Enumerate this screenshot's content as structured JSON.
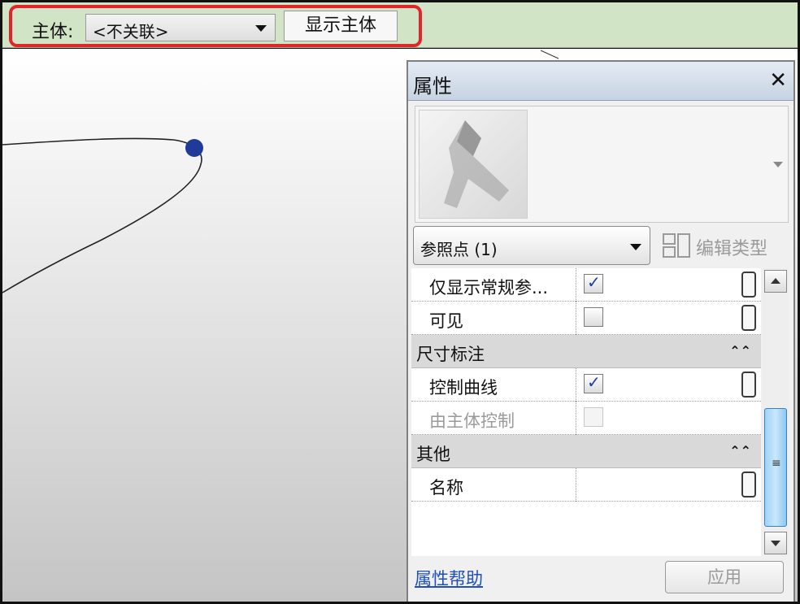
{
  "options_bar": {
    "host_label": "主体:",
    "host_value": "<不关联>",
    "show_host_label": "显示主体"
  },
  "properties": {
    "title": "属性",
    "close_icon": "close-icon",
    "type_selector_value": "参照点 (1)",
    "edit_type_label": "编辑类型",
    "rows": [
      {
        "name": "仅显示常规参...",
        "checked": true,
        "enabled": true
      },
      {
        "name": "可见",
        "checked": false,
        "enabled": true
      }
    ],
    "groups": [
      {
        "name": "尺寸标注",
        "rows": [
          {
            "name": "控制曲线",
            "checked": true,
            "enabled": true
          },
          {
            "name": "由主体控制",
            "checked": false,
            "enabled": false
          }
        ]
      },
      {
        "name": "其他",
        "rows": [
          {
            "name": "名称"
          }
        ]
      }
    ],
    "help_link": "属性帮助",
    "apply_label": "应用"
  },
  "colors": {
    "highlight": "#e1262b",
    "options_bar_bg": "#d2e4c6",
    "point_color": "#1f3a99",
    "scroll_thumb": "#9fd3f4"
  }
}
